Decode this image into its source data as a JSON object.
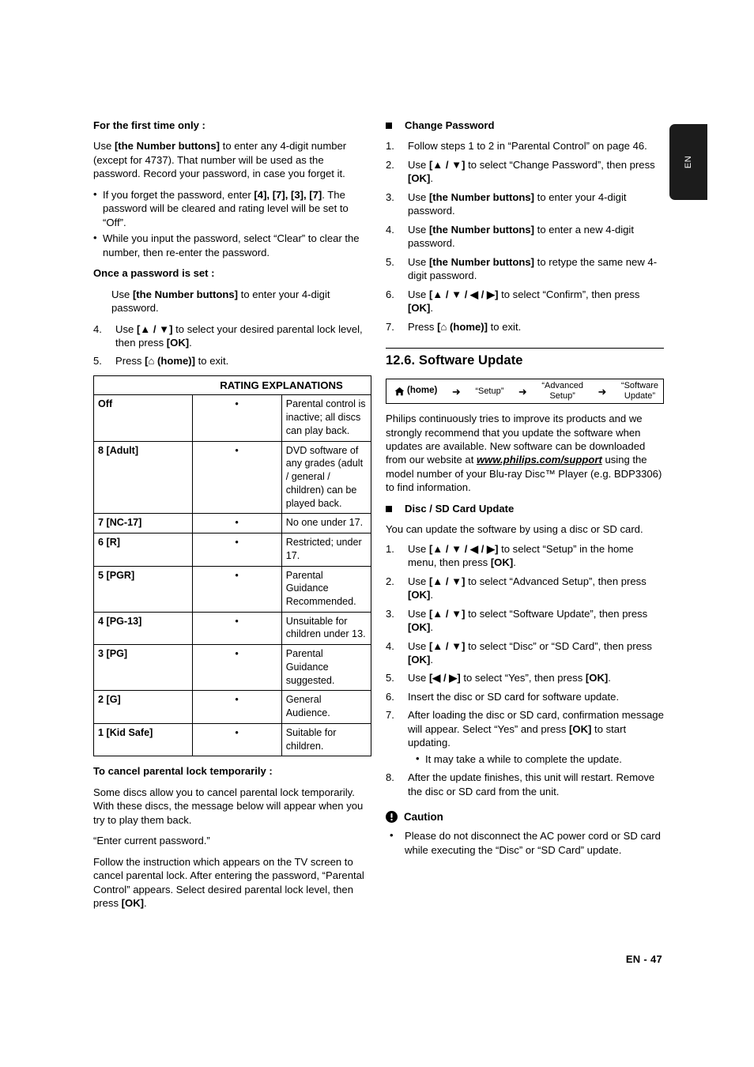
{
  "language_tab": "EN",
  "footer": "EN - 47",
  "left_column": {
    "first_time_heading": "For the first time only :",
    "first_time_para": {
      "a": "Use ",
      "b": "[the Number buttons]",
      "c": " to enter any 4-digit number (except for 4737). That number will be used as the password. Record your password, in case you forget it."
    },
    "first_time_bullets": [
      {
        "a": "If you forget the password, enter ",
        "b": "[4], [7], [3], [7]",
        "c": ". The password will be cleared and rating level will be set to “Off”."
      },
      {
        "a": "While you input the password, select “Clear” to clear the number, then re-enter the password.",
        "b": "",
        "c": ""
      }
    ],
    "once_set_heading": "Once a password is set :",
    "once_set_para": {
      "a": "Use ",
      "b": "[the Number buttons]",
      "c": " to enter your 4-digit password."
    },
    "steps": [
      {
        "num": "4.",
        "a": "Use ",
        "b": "[▲ / ▼]",
        "c": " to select your desired parental lock level, then press ",
        "d": "[OK]",
        "e": "."
      },
      {
        "num": "5.",
        "a": "Press ",
        "b": "[⌂ (home)]",
        "c": " to exit.",
        "d": "",
        "e": ""
      }
    ],
    "table": {
      "header": "RATING EXPLANATIONS",
      "bullet": "•",
      "rows": [
        {
          "level": "Off",
          "desc": "Parental control is inactive; all discs can play back."
        },
        {
          "level": "8 [Adult]",
          "desc": "DVD software of any grades (adult / general / children) can be played back."
        },
        {
          "level": "7 [NC-17]",
          "desc": "No one under 17."
        },
        {
          "level": "6 [R]",
          "desc": "Restricted; under 17."
        },
        {
          "level": "5 [PGR]",
          "desc": "Parental Guidance Recommended."
        },
        {
          "level": "4 [PG-13]",
          "desc": "Unsuitable for children under 13."
        },
        {
          "level": "3 [PG]",
          "desc": "Parental Guidance suggested."
        },
        {
          "level": "2 [G]",
          "desc": "General Audience."
        },
        {
          "level": "1 [Kid Safe]",
          "desc": "Suitable for children."
        }
      ]
    },
    "cancel_heading": "To cancel parental lock temporarily :",
    "cancel_para1": "Some discs allow you to cancel parental lock temporarily. With these discs, the message below will appear when you try to play them back.",
    "cancel_message": "“Enter current password.”",
    "cancel_para2": {
      "a": "Follow the instruction which appears on the TV screen to cancel parental lock. After entering the password, “Parental Control” appears. Select desired parental lock level, then press ",
      "b": "[OK]",
      "c": "."
    }
  },
  "right_column": {
    "change_password_heading": "Change Password",
    "change_password_steps": [
      {
        "num": "1.",
        "a": "Follow steps 1 to 2 in “Parental Control” on page 46.",
        "b": "",
        "c": "",
        "d": "",
        "e": ""
      },
      {
        "num": "2.",
        "a": "Use ",
        "b": "[▲ / ▼]",
        "c": " to select “Change Password”, then press ",
        "d": "[OK]",
        "e": "."
      },
      {
        "num": "3.",
        "a": "Use ",
        "b": "[the Number buttons]",
        "c": " to enter your 4-digit password.",
        "d": "",
        "e": ""
      },
      {
        "num": "4.",
        "a": "Use ",
        "b": "[the Number buttons]",
        "c": " to enter a new 4-digit password.",
        "d": "",
        "e": ""
      },
      {
        "num": "5.",
        "a": "Use ",
        "b": "[the Number buttons]",
        "c": " to retype the same new 4-digit password.",
        "d": "",
        "e": ""
      },
      {
        "num": "6.",
        "a": "Use ",
        "b": "[▲ / ▼ / ◀ / ▶]",
        "c": " to select “Confirm”, then press ",
        "d": "[OK]",
        "e": "."
      },
      {
        "num": "7.",
        "a": "Press ",
        "b": "[⌂ (home)]",
        "c": " to exit.",
        "d": "",
        "e": ""
      }
    ],
    "section_number_title": "12.6. Software Update",
    "navbox": {
      "home_label": "(home)",
      "arrow": "➜",
      "steps": [
        "“Setup”",
        "“Advanced\nSetup”",
        "“Software\nUpdate”"
      ]
    },
    "intro_para": {
      "a": "Philips continuously tries to improve its products and we strongly recommend that you update the software when updates are available. New software can be downloaded from our website at ",
      "url": "www.philips.com/support",
      "c": " using the model number of your Blu-ray Disc™ Player (e.g. BDP3306) to find information."
    },
    "disc_sd_heading": "Disc / SD Card Update",
    "disc_sd_intro": "You can update the software by using a disc or SD card.",
    "disc_sd_steps": [
      {
        "num": "1.",
        "a": "Use ",
        "b": "[▲ / ▼ / ◀ / ▶]",
        "c": " to select “Setup” in the home menu, then press ",
        "d": "[OK]",
        "e": ".",
        "sub": ""
      },
      {
        "num": "2.",
        "a": "Use ",
        "b": "[▲ / ▼]",
        "c": " to select “Advanced Setup”, then  press ",
        "d": "[OK]",
        "e": ".",
        "sub": ""
      },
      {
        "num": "3.",
        "a": "Use ",
        "b": "[▲ / ▼]",
        "c": " to select “Software Update”, then press ",
        "d": "[OK]",
        "e": ".",
        "sub": ""
      },
      {
        "num": "4.",
        "a": "Use ",
        "b": "[▲ / ▼]",
        "c": " to select “Disc” or “SD Card”, then press ",
        "d": "[OK]",
        "e": ".",
        "sub": ""
      },
      {
        "num": "5.",
        "a": "Use ",
        "b": "[◀ / ▶]",
        "c": " to select “Yes”, then press ",
        "d": "[OK]",
        "e": ".",
        "sub": ""
      },
      {
        "num": "6.",
        "a": "Insert the disc or SD card for software update.",
        "b": "",
        "c": "",
        "d": "",
        "e": "",
        "sub": ""
      },
      {
        "num": "7.",
        "a": "After loading the disc or SD card, confirmation message will appear. Select “Yes” and press ",
        "b": "",
        "c": "",
        "d": "[OK]",
        "e": " to start updating.",
        "sub": "It may take a while to complete the update."
      },
      {
        "num": "8.",
        "a": "After the update finishes, this unit will restart. Remove the disc or SD card from the unit.",
        "b": "",
        "c": "",
        "d": "",
        "e": "",
        "sub": ""
      }
    ],
    "caution_heading": "Caution",
    "caution_items": [
      "Please do not disconnect the AC power cord or SD card while executing the “Disc” or “SD Card” update."
    ]
  }
}
